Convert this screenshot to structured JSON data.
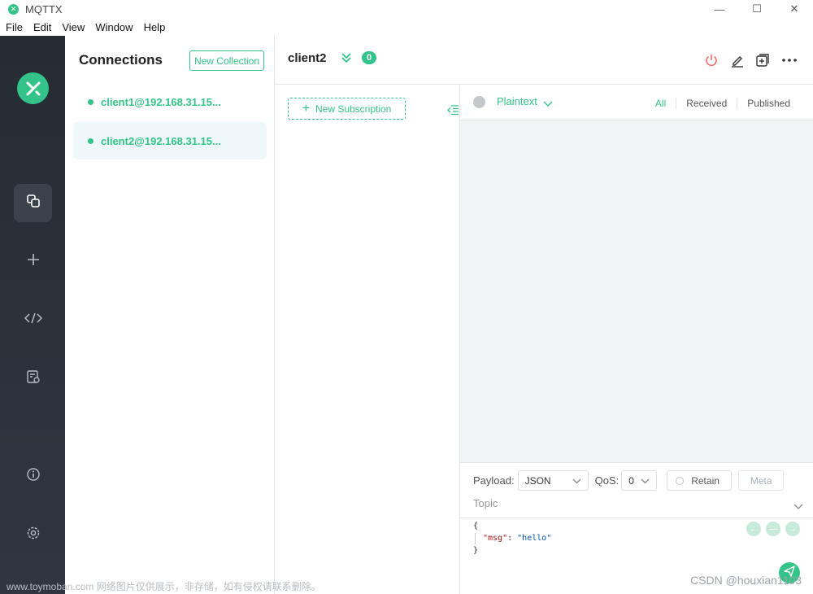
{
  "window": {
    "title": "MQTTX",
    "minimize": "—",
    "maximize": "☐",
    "close": "✕"
  },
  "menu": [
    "File",
    "Edit",
    "View",
    "Window",
    "Help"
  ],
  "rail": {
    "icons": [
      "connections-icon",
      "plus-icon",
      "code-icon",
      "log-icon",
      "info-icon",
      "settings-icon"
    ]
  },
  "connections": {
    "title": "Connections",
    "new_collection": "New Collection",
    "items": [
      {
        "label": "client1@192.168.31.15...",
        "active": false
      },
      {
        "label": "client2@192.168.31.15...",
        "active": true
      }
    ]
  },
  "client": {
    "name": "client2",
    "message_count": "0"
  },
  "subscriptions": {
    "new_label": "New Subscription"
  },
  "messages": {
    "format": "Plaintext",
    "filters": [
      "All",
      "Received",
      "Published"
    ],
    "active_filter": "All"
  },
  "publish": {
    "payload_label": "Payload:",
    "payload_format": "JSON",
    "qos_label": "QoS:",
    "qos_value": "0",
    "retain_label": "Retain",
    "meta_label": "Meta",
    "topic_placeholder": "Topic",
    "code": {
      "line1": "{",
      "key": "\"msg\"",
      "sep": ": ",
      "value": "\"hello\"",
      "line3": "}"
    }
  },
  "watermarks": {
    "left": "www.toymoban.com 网络图片仅供展示，非存储，如有侵权请联系删除。",
    "right": "CSDN @houxian1103"
  },
  "colors": {
    "accent": "#34c388",
    "rail": "#2a3138",
    "danger": "#f56c6c"
  }
}
